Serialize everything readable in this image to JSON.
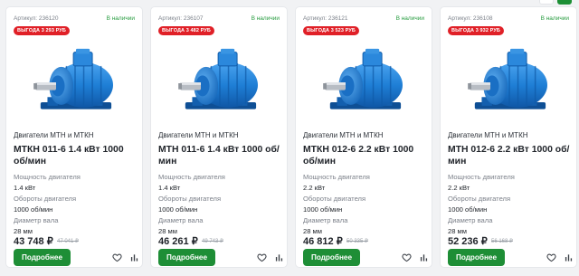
{
  "products": [
    {
      "sku": "Артикул: 236120",
      "stock": "В наличии",
      "badge": "ВЫГОДА 3 293 РУБ",
      "category": "Двигатели МТН и МТКН",
      "title": "МТКН 011-6 1.4 кВт 1000 об/мин",
      "specs": [
        {
          "label": "Мощность двигателя",
          "value": "1.4 кВт"
        },
        {
          "label": "Обороты двигателя",
          "value": "1000 об/мин"
        },
        {
          "label": "Диаметр вала",
          "value": "28 мм"
        }
      ],
      "price": "43 748 ₽",
      "old_price": "47 041 ₽",
      "button": "Подробнее"
    },
    {
      "sku": "Артикул: 236107",
      "stock": "В наличии",
      "badge": "ВЫГОДА 3 482 РУБ",
      "category": "Двигатели МТН и МТКН",
      "title": "МТН 011-6 1.4 кВт 1000 об/мин",
      "specs": [
        {
          "label": "Мощность двигателя",
          "value": "1.4 кВт"
        },
        {
          "label": "Обороты двигателя",
          "value": "1000 об/мин"
        },
        {
          "label": "Диаметр вала",
          "value": "28 мм"
        }
      ],
      "price": "46 261 ₽",
      "old_price": "49 743 ₽",
      "button": "Подробнее"
    },
    {
      "sku": "Артикул: 236121",
      "stock": "В наличии",
      "badge": "ВЫГОДА 3 523 РУБ",
      "category": "Двигатели МТН и МТКН",
      "title": "МТКН 012-6 2.2 кВт 1000 об/мин",
      "specs": [
        {
          "label": "Мощность двигателя",
          "value": "2.2 кВт"
        },
        {
          "label": "Обороты двигателя",
          "value": "1000 об/мин"
        },
        {
          "label": "Диаметр вала",
          "value": "28 мм"
        }
      ],
      "price": "46 812 ₽",
      "old_price": "50 335 ₽",
      "button": "Подробнее"
    },
    {
      "sku": "Артикул: 236108",
      "stock": "В наличии",
      "badge": "ВЫГОДА 3 932 РУБ",
      "category": "Двигатели МТН и МТКН",
      "title": "МТН 012-6 2.2 кВт 1000 об/мин",
      "specs": [
        {
          "label": "Мощность двигателя",
          "value": "2.2 кВт"
        },
        {
          "label": "Обороты двигателя",
          "value": "1000 об/мин"
        },
        {
          "label": "Диаметр вала",
          "value": "28 мм"
        }
      ],
      "price": "52 236 ₽",
      "old_price": "56 168 ₽",
      "button": "Подробнее"
    }
  ],
  "icons": {
    "favorite": "heart-icon",
    "compare": "bar-chart-icon",
    "product_image": "electric-motor-image"
  },
  "colors": {
    "accent_green": "#1e8e36",
    "badge_red": "#e02027",
    "stock_green": "#2a9d42",
    "motor_blue": "#1f7fd6"
  }
}
